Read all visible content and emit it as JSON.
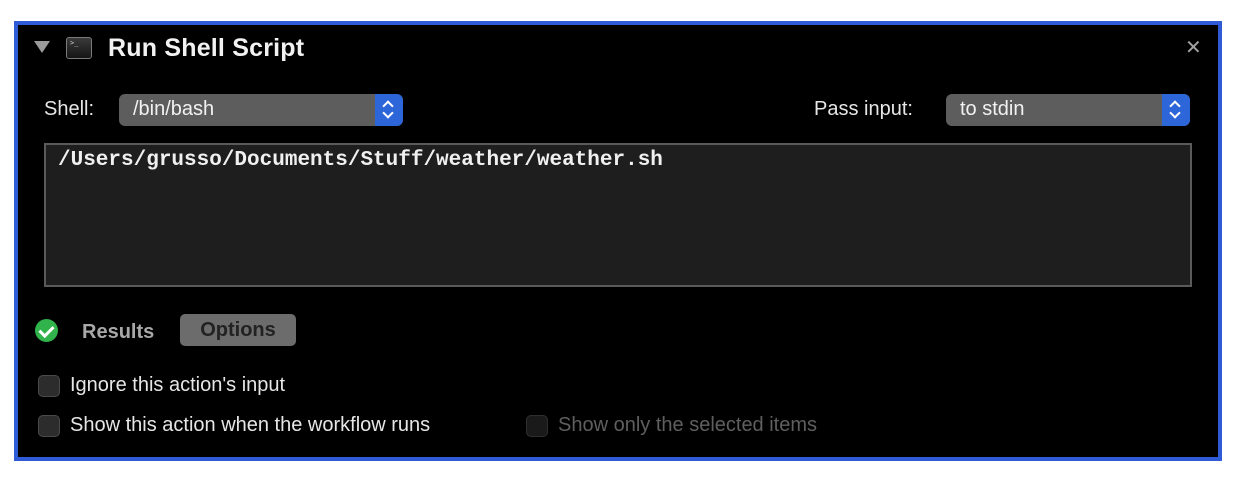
{
  "action": {
    "title": "Run Shell Script",
    "close_glyph": "✕"
  },
  "shell": {
    "label": "Shell:",
    "value": "/bin/bash"
  },
  "pass_input": {
    "label": "Pass input:",
    "value": "to stdin"
  },
  "script": {
    "content": "/Users/grusso/Documents/Stuff/weather/weather.sh"
  },
  "tabs": {
    "status": "success",
    "results_label": "Results",
    "options_label": "Options",
    "selected": "Options"
  },
  "options": {
    "ignore_input": {
      "label": "Ignore this action's input",
      "checked": false
    },
    "show_when_runs": {
      "label": "Show this action when the workflow runs",
      "checked": false
    },
    "show_only_selected": {
      "label": "Show only the selected items",
      "checked": false,
      "enabled": false
    }
  },
  "colors": {
    "frame_border": "#2f5cd6",
    "background": "#000000",
    "popup_accent": "#2d66d8",
    "status_ok": "#2fb34a"
  }
}
